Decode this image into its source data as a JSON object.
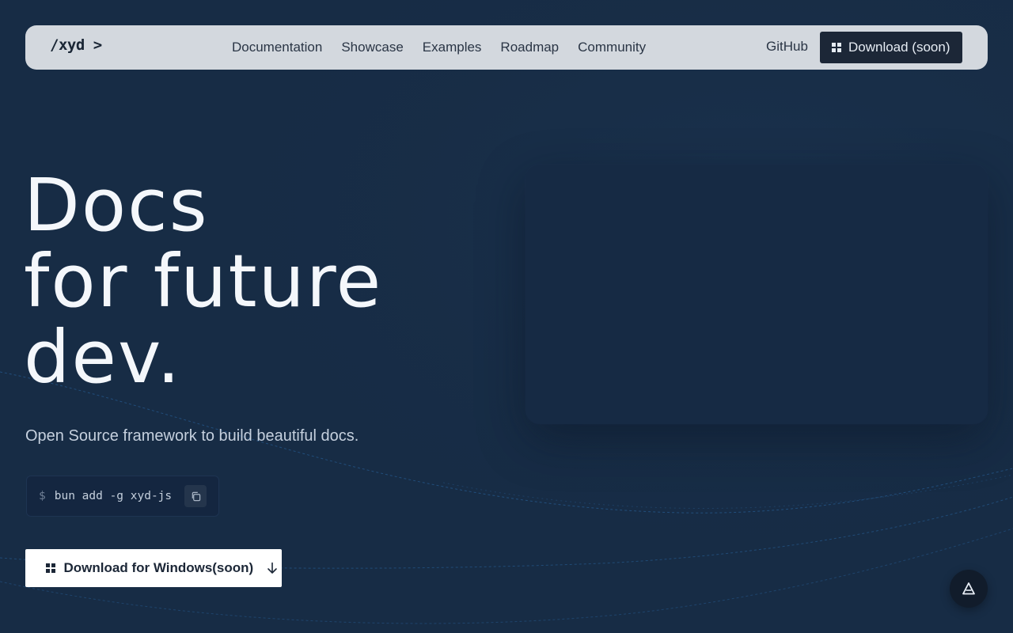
{
  "nav": {
    "logo": "/xyd >",
    "links": [
      "Documentation",
      "Showcase",
      "Examples",
      "Roadmap",
      "Community"
    ],
    "github": "GitHub",
    "download_label": "Download (soon)"
  },
  "hero": {
    "title_lines": [
      "Docs",
      "for future",
      "dev."
    ],
    "subtitle": "Open Source framework to build beautiful docs.",
    "command": {
      "prompt": "$",
      "text": "bun add -g xyd-js"
    },
    "download_windows_label": "Download for Windows(soon)"
  },
  "icons": {
    "windows": "windows-icon",
    "copy": "copy-icon",
    "arrow": "arrow-down-icon",
    "fab": "triangle-a-icon"
  },
  "colors": {
    "background": "#172c45",
    "nav_background": "#d3d8de",
    "dark_button": "#1c2737",
    "accent_lines": "#2a6aa8"
  }
}
